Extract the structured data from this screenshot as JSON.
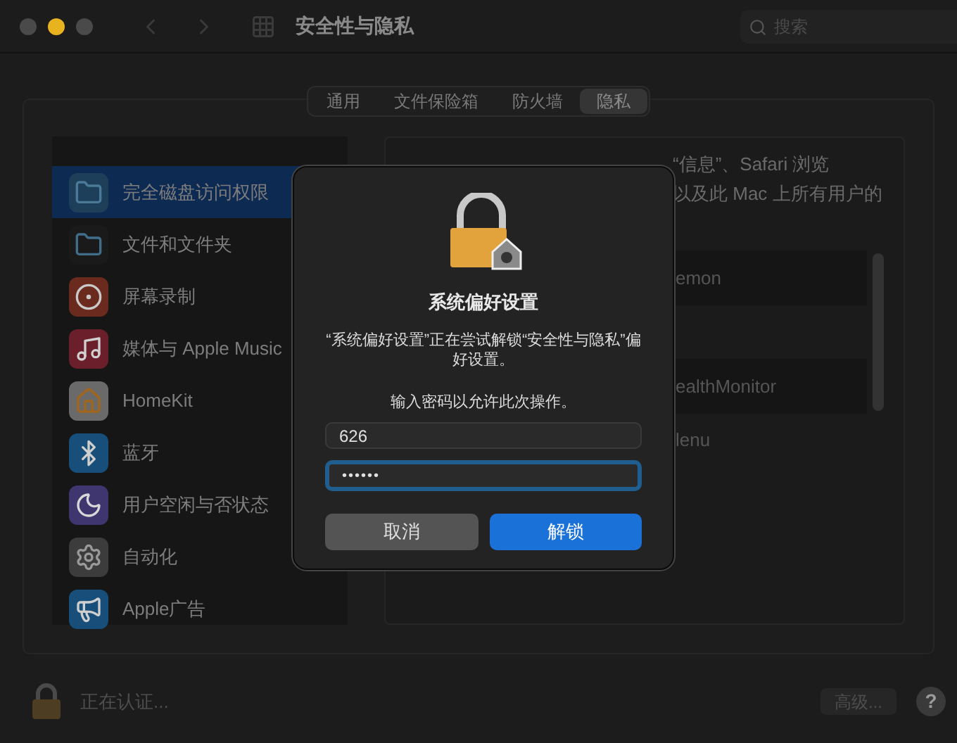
{
  "window": {
    "title": "安全性与隐私"
  },
  "search": {
    "placeholder": "搜索"
  },
  "tabs": [
    {
      "label": "通用",
      "selected": false
    },
    {
      "label": "文件保险箱",
      "selected": false
    },
    {
      "label": "防火墙",
      "selected": false
    },
    {
      "label": "隐私",
      "selected": true
    }
  ],
  "sidebar": {
    "items": [
      {
        "label": "完全磁盘访问权限",
        "selected": true
      },
      {
        "label": "文件和文件夹",
        "selected": false
      },
      {
        "label": "屏幕录制",
        "selected": false
      },
      {
        "label": "媒体与 Apple Music",
        "selected": false
      },
      {
        "label": "HomeKit",
        "selected": false
      },
      {
        "label": "蓝牙",
        "selected": false
      },
      {
        "label": "用户空闲与否状态",
        "selected": false
      },
      {
        "label": "自动化",
        "selected": false
      },
      {
        "label": "Apple广告",
        "selected": false
      }
    ]
  },
  "right_panel": {
    "description_lines": [
      "“信息”、Safari 浏览",
      "以及此 Mac 上所有用户的"
    ],
    "app_rows": [
      "emon",
      "",
      "ealthMonitor",
      "lenu"
    ]
  },
  "dialog": {
    "title": "系统偏好设置",
    "message": "“系统偏好设置”正在尝试解锁“安全性与隐私”偏好设置。",
    "prompt": "输入密码以允许此次操作。",
    "fields": [
      {
        "kind": "text",
        "value": "626",
        "focused": false
      },
      {
        "kind": "password",
        "value": "••••••",
        "focused": true
      }
    ],
    "buttons": [
      {
        "label": "取消",
        "kind": "secondary"
      },
      {
        "label": "解锁",
        "kind": "primary"
      }
    ]
  },
  "status": {
    "text": "正在认证..."
  },
  "advanced_button": {
    "label": "高级..."
  },
  "help_button": {
    "label": "?"
  }
}
